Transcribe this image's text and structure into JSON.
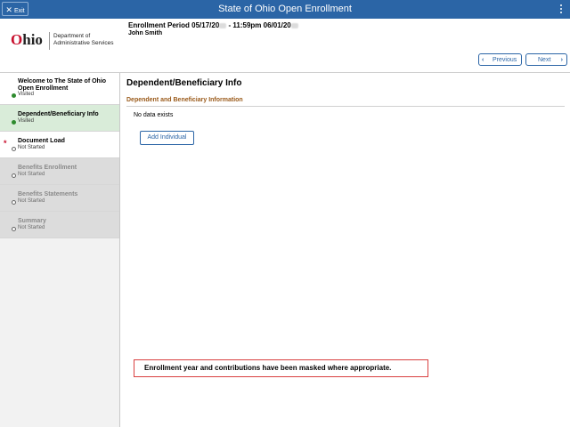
{
  "titlebar": {
    "exit_label": "Exit",
    "title": "State of Ohio Open Enrollment"
  },
  "header": {
    "logo_text_o": "O",
    "logo_text_rest": "hio",
    "dept_line1": "Department of",
    "dept_line2": "Administrative Services",
    "period_a": "Enrollment Period 05/17/20",
    "period_b": " - 11:59pm 06/01/20",
    "user_name": "John Smith",
    "previous_label": "Previous",
    "next_label": "Next"
  },
  "sidebar": {
    "steps": [
      {
        "label": "Welcome to The State of Ohio Open Enrollment",
        "status": "Visited"
      },
      {
        "label": "Dependent/Beneficiary Info",
        "status": "Visited"
      },
      {
        "label": "Document Load",
        "status": "Not Started",
        "required_mark": "*"
      },
      {
        "label": "Benefits Enrollment",
        "status": "Not Started"
      },
      {
        "label": "Benefits Statements",
        "status": "Not Started"
      },
      {
        "label": "Summary",
        "status": "Not Started"
      }
    ]
  },
  "main": {
    "title": "Dependent/Beneficiary Info",
    "section_title": "Dependent and Beneficiary Information",
    "no_data": "No data exists",
    "add_button": "Add Individual"
  },
  "notice": "Enrollment year and contributions have been masked where appropriate.",
  "colors": {
    "titlebar": "#2b65a6",
    "visited_dot": "#2e8b2e",
    "active_step_bg": "#d9ecd9",
    "section_title": "#9a5a1a",
    "notice_border": "#d94040"
  }
}
